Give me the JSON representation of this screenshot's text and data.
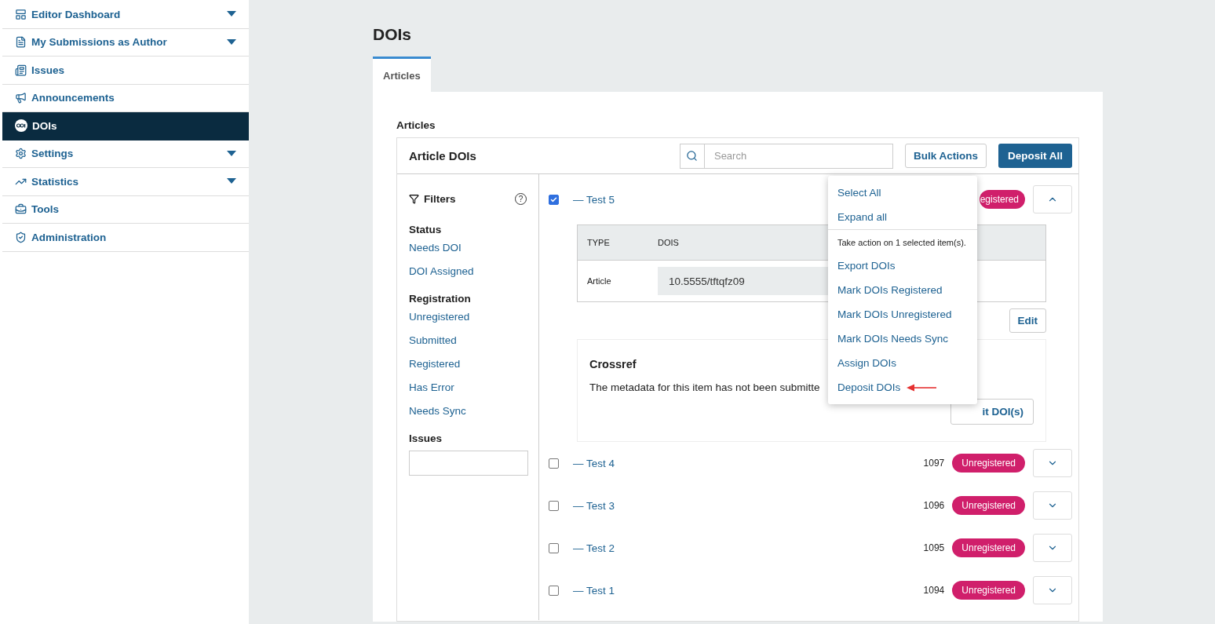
{
  "sidebar": {
    "items": [
      {
        "label": "Editor Dashboard",
        "submenu": true,
        "selected": false
      },
      {
        "label": "My Submissions as Author",
        "submenu": true,
        "selected": false
      },
      {
        "label": "Issues",
        "submenu": false,
        "selected": false
      },
      {
        "label": "Announcements",
        "submenu": false,
        "selected": false
      },
      {
        "label": "DOIs",
        "submenu": false,
        "selected": true
      },
      {
        "label": "Settings",
        "submenu": true,
        "selected": false
      },
      {
        "label": "Statistics",
        "submenu": true,
        "selected": false
      },
      {
        "label": "Tools",
        "submenu": false,
        "selected": false
      },
      {
        "label": "Administration",
        "submenu": false,
        "selected": false
      }
    ]
  },
  "page_title": "DOIs",
  "tabs": [
    {
      "label": "Articles",
      "selected": true
    }
  ],
  "section_label": "Articles",
  "panel": {
    "title": "Article DOIs",
    "search": {
      "placeholder": "Search"
    },
    "bulk_button": "Bulk Actions",
    "deposit_button": "Deposit All"
  },
  "filters": {
    "title": "Filters",
    "help": "?",
    "groups": [
      {
        "heading": "Status",
        "options": [
          "Needs DOI",
          "DOI Assigned"
        ]
      },
      {
        "heading": "Registration",
        "options": [
          "Unregistered",
          "Submitted",
          "Registered",
          "Has Error",
          "Needs Sync"
        ]
      },
      {
        "heading": "Issues",
        "field": true
      }
    ]
  },
  "rows": [
    {
      "title": "— Test 5",
      "checked": true,
      "expanded": true,
      "status": "egistered",
      "details": {
        "columns": [
          "TYPE",
          "DOIS"
        ],
        "items": [
          {
            "type": "Article",
            "doi": "10.5555/tftqfz09"
          }
        ],
        "edit_button": "Edit",
        "crossref": {
          "title": "Crossref",
          "text": "The metadata for this item has not been submitte",
          "button": "it DOI(s)"
        }
      }
    },
    {
      "title": "— Test 4",
      "checked": false,
      "expanded": false,
      "id": "1097",
      "status": "Unregistered"
    },
    {
      "title": "— Test 3",
      "checked": false,
      "expanded": false,
      "id": "1096",
      "status": "Unregistered"
    },
    {
      "title": "— Test 2",
      "checked": false,
      "expanded": false,
      "id": "1095",
      "status": "Unregistered"
    },
    {
      "title": "— Test 1",
      "checked": false,
      "expanded": false,
      "id": "1094",
      "status": "Unregistered"
    }
  ],
  "bulk_menu": {
    "sections": [
      {
        "items": [
          {
            "label": "Select All",
            "marked": false
          },
          {
            "label": "Expand all",
            "marked": false
          }
        ]
      },
      {
        "note": "Take action on 1 selected item(s).",
        "items": [
          {
            "label": "Export DOIs",
            "marked": false
          },
          {
            "label": "Mark DOIs Registered",
            "marked": false
          },
          {
            "label": "Mark DOIs Unregistered",
            "marked": false
          },
          {
            "label": "Mark DOIs Needs Sync",
            "marked": false
          },
          {
            "label": "Assign DOIs",
            "marked": false
          },
          {
            "label": "Deposit DOIs",
            "marked": true
          }
        ]
      }
    ]
  }
}
